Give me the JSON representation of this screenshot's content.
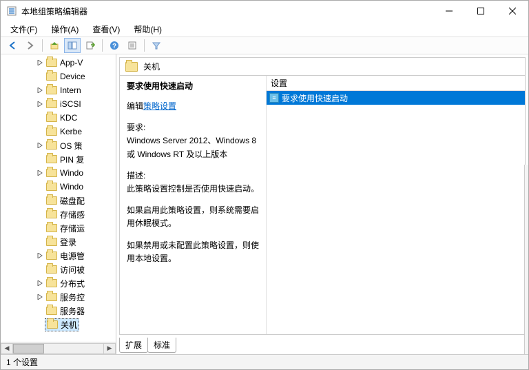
{
  "window": {
    "title": "本地组策略编辑器"
  },
  "menu": {
    "file": "文件(F)",
    "action": "操作(A)",
    "view": "查看(V)",
    "help": "帮助(H)"
  },
  "tree": {
    "items": [
      {
        "label": "App-V",
        "expandable": true
      },
      {
        "label": "Device",
        "expandable": false
      },
      {
        "label": "Intern",
        "expandable": true
      },
      {
        "label": "iSCSI",
        "expandable": true
      },
      {
        "label": "KDC",
        "expandable": false
      },
      {
        "label": "Kerbe",
        "expandable": false
      },
      {
        "label": "OS 策",
        "expandable": true
      },
      {
        "label": "PIN 复",
        "expandable": false
      },
      {
        "label": "Windo",
        "expandable": true
      },
      {
        "label": "Windo",
        "expandable": false
      },
      {
        "label": "磁盘配",
        "expandable": false
      },
      {
        "label": "存储感",
        "expandable": false
      },
      {
        "label": "存储运",
        "expandable": false
      },
      {
        "label": "登录",
        "expandable": false
      },
      {
        "label": "电源管",
        "expandable": true
      },
      {
        "label": "访问被",
        "expandable": false
      },
      {
        "label": "分布式",
        "expandable": true
      },
      {
        "label": "服务控",
        "expandable": true
      },
      {
        "label": "服务器",
        "expandable": false
      },
      {
        "label": "关机",
        "expandable": false,
        "selected": true
      }
    ]
  },
  "crumb": {
    "label": "关机"
  },
  "detail": {
    "title": "要求使用快速启动",
    "edit_prefix": "编辑",
    "edit_link": "策略设置",
    "req_label": "要求:",
    "req_text": "Windows Server 2012、Windows 8 或 Windows RT 及以上版本",
    "desc_label": "描述:",
    "desc_p1": "此策略设置控制是否使用快速启动。",
    "desc_p2": "如果启用此策略设置，则系统需要启用休眠模式。",
    "desc_p3": "如果禁用或未配置此策略设置，则使用本地设置。"
  },
  "list": {
    "header": "设置",
    "items": [
      {
        "label": "要求使用快速启动",
        "selected": true
      }
    ]
  },
  "tabs": {
    "extended": "扩展",
    "standard": "标准"
  },
  "status": {
    "text": "1 个设置"
  }
}
